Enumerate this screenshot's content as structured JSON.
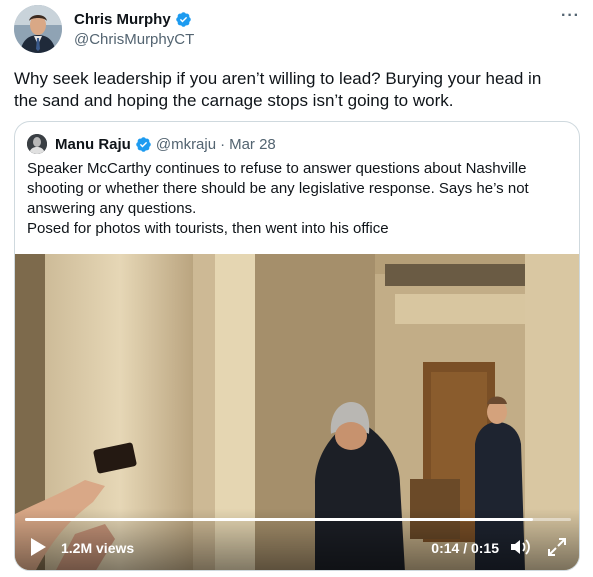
{
  "author": {
    "name": "Chris Murphy",
    "handle": "@ChrisMurphyCT",
    "verified": true
  },
  "tweet": {
    "line1": "Why seek leadership if you aren’t willing to lead? Burying your head in",
    "line2": "the sand and hoping the carnage stops isn’t going to work."
  },
  "quoted": {
    "name": "Manu Raju",
    "handle": "@mkraju",
    "separator": "·",
    "date": "Mar 28",
    "lines": [
      "Speaker McCarthy continues to refuse to answer questions about Nashville",
      "shooting or whether there should be any legislative response. Says he’s not",
      "answering any questions.",
      "Posed for photos with tourists, then went into his office"
    ]
  },
  "video": {
    "views": "1.2M views",
    "time": "0:14 / 0:15",
    "progress": 0.93
  },
  "colors": {
    "verified": "#1d9bf0",
    "text": "#0f1419",
    "secondary": "#536471",
    "border": "#cfd9de"
  },
  "icons": [
    "verified-badge-icon",
    "more-icon",
    "play-icon",
    "volume-icon",
    "fullscreen-icon"
  ]
}
